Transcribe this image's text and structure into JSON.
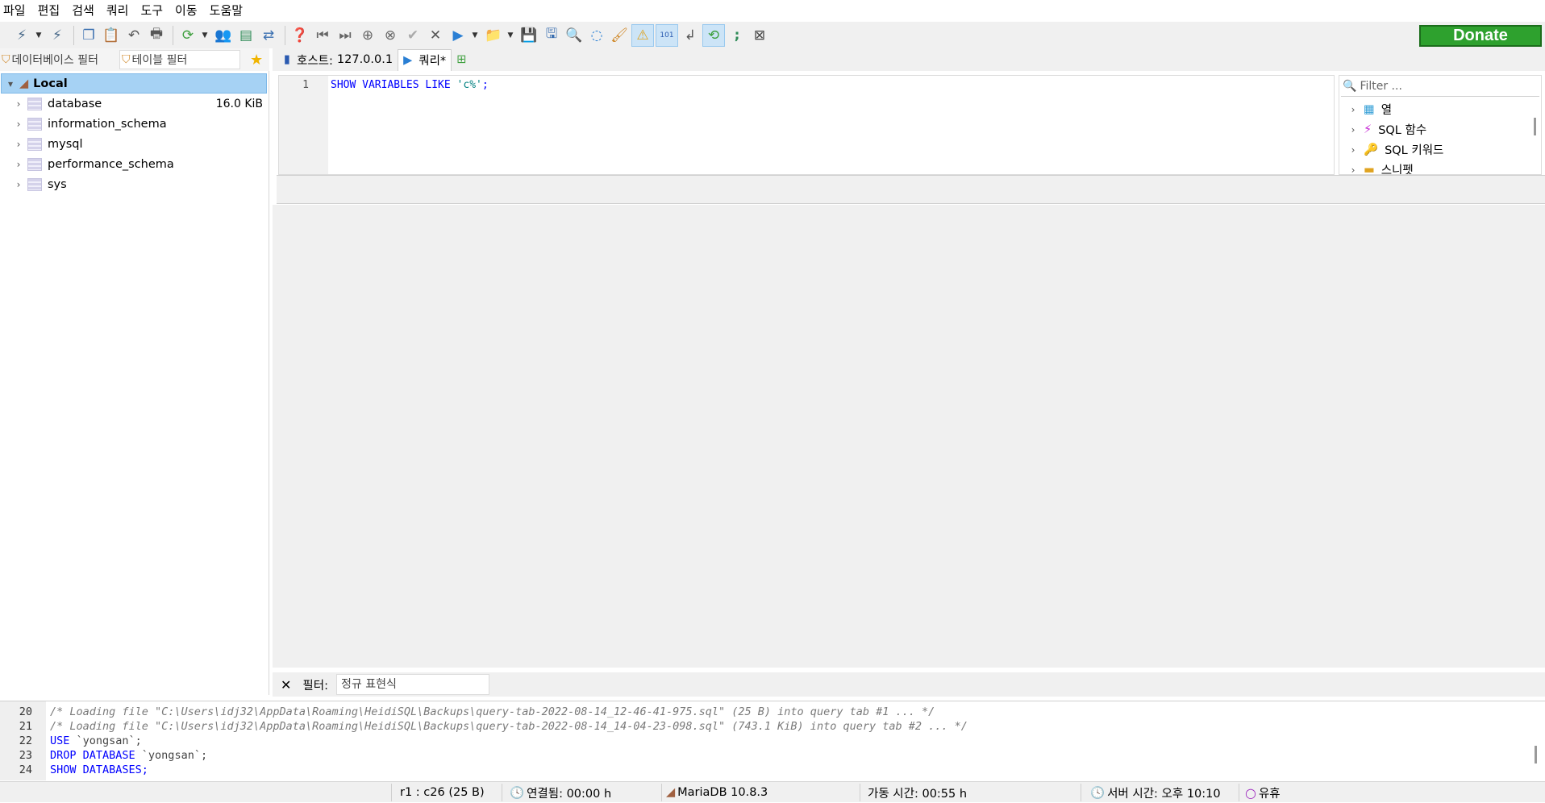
{
  "menu": [
    "파일",
    "편집",
    "검색",
    "쿼리",
    "도구",
    "이동",
    "도움말"
  ],
  "toolbar": {
    "donate_label": "Donate"
  },
  "left": {
    "db_filter_placeholder": "데이터베이스 필터",
    "table_filter_placeholder": "테이블 필터",
    "root_label": "Local",
    "databases": [
      {
        "name": "database",
        "size": "16.0 KiB"
      },
      {
        "name": "information_schema",
        "size": ""
      },
      {
        "name": "mysql",
        "size": ""
      },
      {
        "name": "performance_schema",
        "size": ""
      },
      {
        "name": "sys",
        "size": ""
      }
    ]
  },
  "tabs": {
    "host_label": "호스트:",
    "host_value": "127.0.0.1",
    "query_label": "쿼리*"
  },
  "editor": {
    "line_number": "1",
    "kw1": "SHOW VARIABLES LIKE",
    "str": "'c%'",
    "end": ";"
  },
  "helpers": {
    "filter_placeholder": "Filter ...",
    "items": [
      "열",
      "SQL 함수",
      "SQL 키워드",
      "스니펫"
    ]
  },
  "filter_bar": {
    "label": "필터:",
    "regex_placeholder": "정규 표현식"
  },
  "log": [
    {
      "num": "20",
      "text": "/* Loading file \"C:\\Users\\idj32\\AppData\\Roaming\\HeidiSQL\\Backups\\query-tab-2022-08-14_12-46-41-975.sql\" (25 B) into query tab #1 ... */"
    },
    {
      "num": "21",
      "text": "/* Loading file \"C:\\Users\\idj32\\AppData\\Roaming\\HeidiSQL\\Backups\\query-tab-2022-08-14_14-04-23-098.sql\" (743.1 KiB) into query tab #2 ... */"
    },
    {
      "num": "22",
      "kw": "USE",
      "rest": " `yongsan`;"
    },
    {
      "num": "23",
      "kw": "DROP DATABASE",
      "rest": " `yongsan`;"
    },
    {
      "num": "24",
      "kw": "SHOW DATABASES",
      "rest": ";"
    }
  ],
  "status": {
    "cursor": "r1 : c26 (25 B)",
    "connected": "연결됨: 00:00 h",
    "server": "MariaDB 10.8.3",
    "uptime": "가동 시간: 00:55 h",
    "server_time": "서버 시간: 오후 10:10",
    "idle": "유휴"
  },
  "colors": {
    "selection": "#a6d2f4",
    "donate": "#2ea12e",
    "keyword": "#0000ff",
    "string": "#008080"
  }
}
